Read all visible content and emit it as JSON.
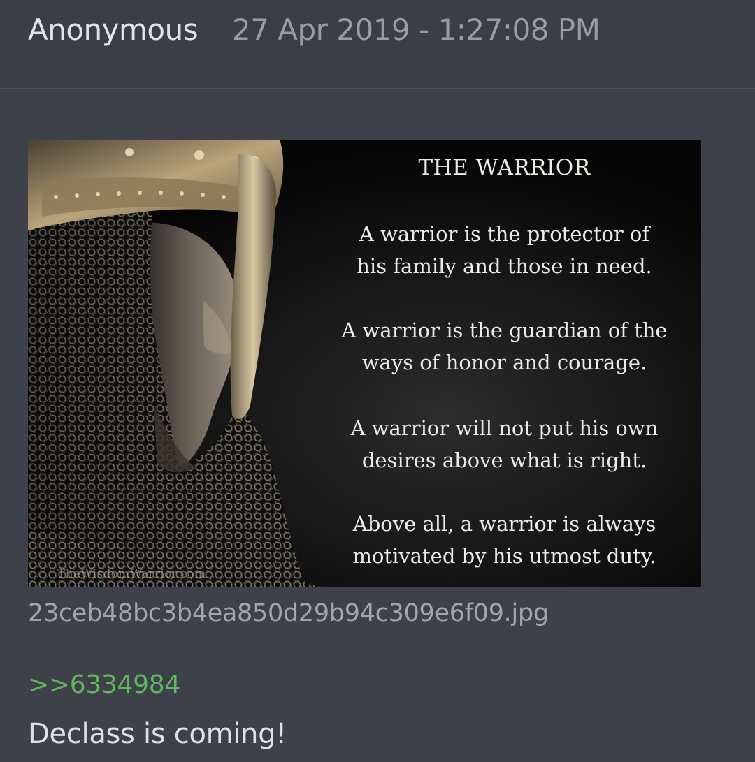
{
  "post": {
    "author": "Anonymous",
    "timestamp": "27 Apr 2019 - 1:27:08 PM",
    "attachment": {
      "filename": "23ceb48bc3b4ea850d29b94c309e6f09.jpg",
      "image": {
        "title": "THE WARRIOR",
        "paragraphs": [
          {
            "line1": "A warrior is the protector of",
            "line2": "his family and those in need."
          },
          {
            "line1": "A warrior is the guardian of the",
            "line2": "ways of honor and courage."
          },
          {
            "line1": "A warrior will not put his own",
            "line2": "desires above what is right."
          },
          {
            "line1": "Above all, a warrior is always",
            "line2": "motivated by his utmost duty."
          }
        ],
        "watermark": "TheWisdomWarrior.com"
      }
    },
    "reply_link": ">>6334984",
    "message": "Declass is coming!"
  },
  "colors": {
    "background": "#3f414a",
    "header_background": "#3c3e46",
    "author_text": "#e2e3e7",
    "timestamp_text": "#9a9ca4",
    "reply_link": "#5fb85d",
    "message_text": "#e0e1e5"
  }
}
